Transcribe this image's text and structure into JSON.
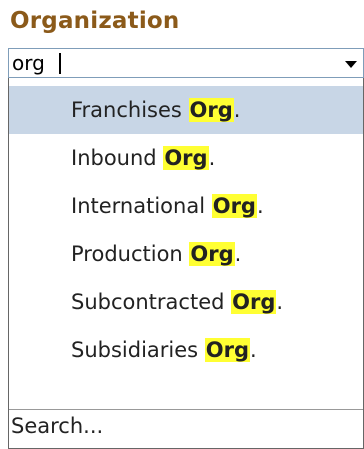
{
  "field": {
    "label": "Organization",
    "value": "org"
  },
  "options": [
    {
      "text": "Franchises ",
      "match": "Org",
      "suffix": ".",
      "selected": true
    },
    {
      "text": "Inbound ",
      "match": "Org",
      "suffix": ".",
      "selected": false
    },
    {
      "text": "International ",
      "match": "Org",
      "suffix": ".",
      "selected": false
    },
    {
      "text": "Production ",
      "match": "Org",
      "suffix": ".",
      "selected": false
    },
    {
      "text": "Subcontracted ",
      "match": "Org",
      "suffix": ".",
      "selected": false
    },
    {
      "text": "Subsidiaries ",
      "match": "Org",
      "suffix": ".",
      "selected": false
    }
  ],
  "footer": {
    "search_label": "Search..."
  },
  "colors": {
    "label": "#8b5a1a",
    "selected_row": "#c8d6e6",
    "highlight": "#ffff33"
  },
  "icons": {
    "dropdown_button": "chevron-down-icon"
  }
}
